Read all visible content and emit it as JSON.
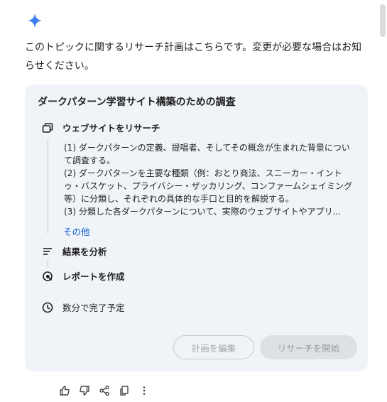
{
  "intro": {
    "text": "このトピックに関するリサーチ計画はこちらです。変更が必要な場合はお知らせください。"
  },
  "plan": {
    "title": "ダークパターン学習サイト構築のための調査",
    "steps": [
      {
        "label": "ウェブサイトをリサーチ",
        "icon": "browser-tabs-icon"
      },
      {
        "label": "結果を分析",
        "icon": "analyze-lines-icon"
      },
      {
        "label": "レポートを作成",
        "icon": "report-search-icon"
      }
    ],
    "details": [
      "(1) ダークパターンの定義、提唱者、そしてその概念が生まれた背景について調査する。",
      "(2) ダークパターンを主要な種類（例：おとり商法、スニーカー・イントゥ・バスケット、プライバシー・ザッカリング、コンファームシェイミング等）に分類し、それぞれの具体的な手口と目的を解説する。",
      "(3) 分類した各ダークパターンについて、実際のウェブサイトやアプリ..."
    ],
    "more_label": "その他",
    "eta_label": "数分で完了予定",
    "edit_button": "計画を編集",
    "start_button": "リサーチを開始"
  },
  "colors": {
    "accent": "#0b57d0",
    "card_bg": "#f0f4f9",
    "spark_blue": "#4285f4"
  },
  "actions": [
    {
      "name": "thumbs-up-icon"
    },
    {
      "name": "thumbs-down-icon"
    },
    {
      "name": "share-icon"
    },
    {
      "name": "copy-icon"
    },
    {
      "name": "more-vert-icon"
    }
  ]
}
